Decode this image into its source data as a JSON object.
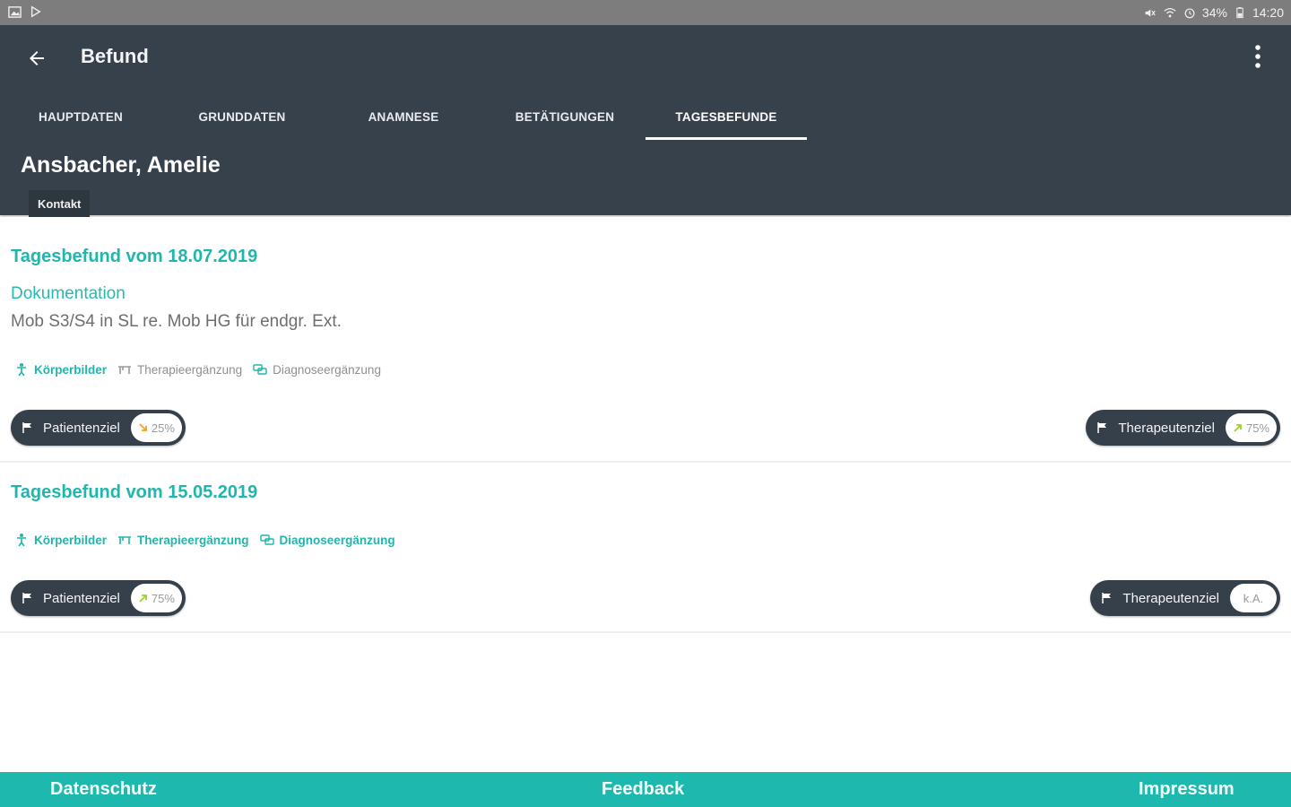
{
  "status_bar": {
    "left_icons": [
      "image-icon",
      "play-store-icon"
    ],
    "right_icons": [
      "mute-icon",
      "wifi-icon",
      "alarm-icon"
    ],
    "battery": "34%",
    "time": "14:20"
  },
  "header": {
    "title": "Befund",
    "back_icon": "arrow-left-icon",
    "menu_icon": "more-vert-icon"
  },
  "tabs": [
    {
      "label": "HAUPTDATEN",
      "active": false
    },
    {
      "label": "GRUNDDATEN",
      "active": false
    },
    {
      "label": "ANAMNESE",
      "active": false
    },
    {
      "label": "BETÄTIGUNGEN",
      "active": false
    },
    {
      "label": "TAGESBEFUNDE",
      "active": true
    }
  ],
  "patient": {
    "name": "Ansbacher, Amelie",
    "contact_label": "Kontakt"
  },
  "entries": [
    {
      "title": "Tagesbefund vom 18.07.2019",
      "doc_label": "Dokumentation",
      "doc_text": "Mob S3/S4 in SL re. Mob HG für endgr. Ext.",
      "links": {
        "koerperbilder": "Körperbilder",
        "therapie": "Therapieergänzung",
        "diagnose": "Diagnoseergänzung"
      },
      "links_active": [
        true,
        false,
        false
      ],
      "patient_goal": {
        "label": "Patientenziel",
        "value": "25%",
        "trend": "down"
      },
      "therapist_goal": {
        "label": "Therapeutenziel",
        "value": "75%",
        "trend": "up"
      }
    },
    {
      "title": "Tagesbefund vom 15.05.2019",
      "links": {
        "koerperbilder": "Körperbilder",
        "therapie": "Therapieergänzung",
        "diagnose": "Diagnoseergänzung"
      },
      "links_active": [
        true,
        true,
        true
      ],
      "patient_goal": {
        "label": "Patientenziel",
        "value": "75%",
        "trend": "up"
      },
      "therapist_goal": {
        "label": "Therapeutenziel",
        "value": "k.A."
      }
    }
  ],
  "colors": {
    "header_bg": "#37414b",
    "accent": "#1fb6ad",
    "footer_bg": "#1db8ae",
    "trend_down": "#f0a020",
    "trend_up": "#9bd22c"
  },
  "footer": {
    "privacy": "Datenschutz",
    "feedback": "Feedback",
    "imprint": "Impressum"
  }
}
